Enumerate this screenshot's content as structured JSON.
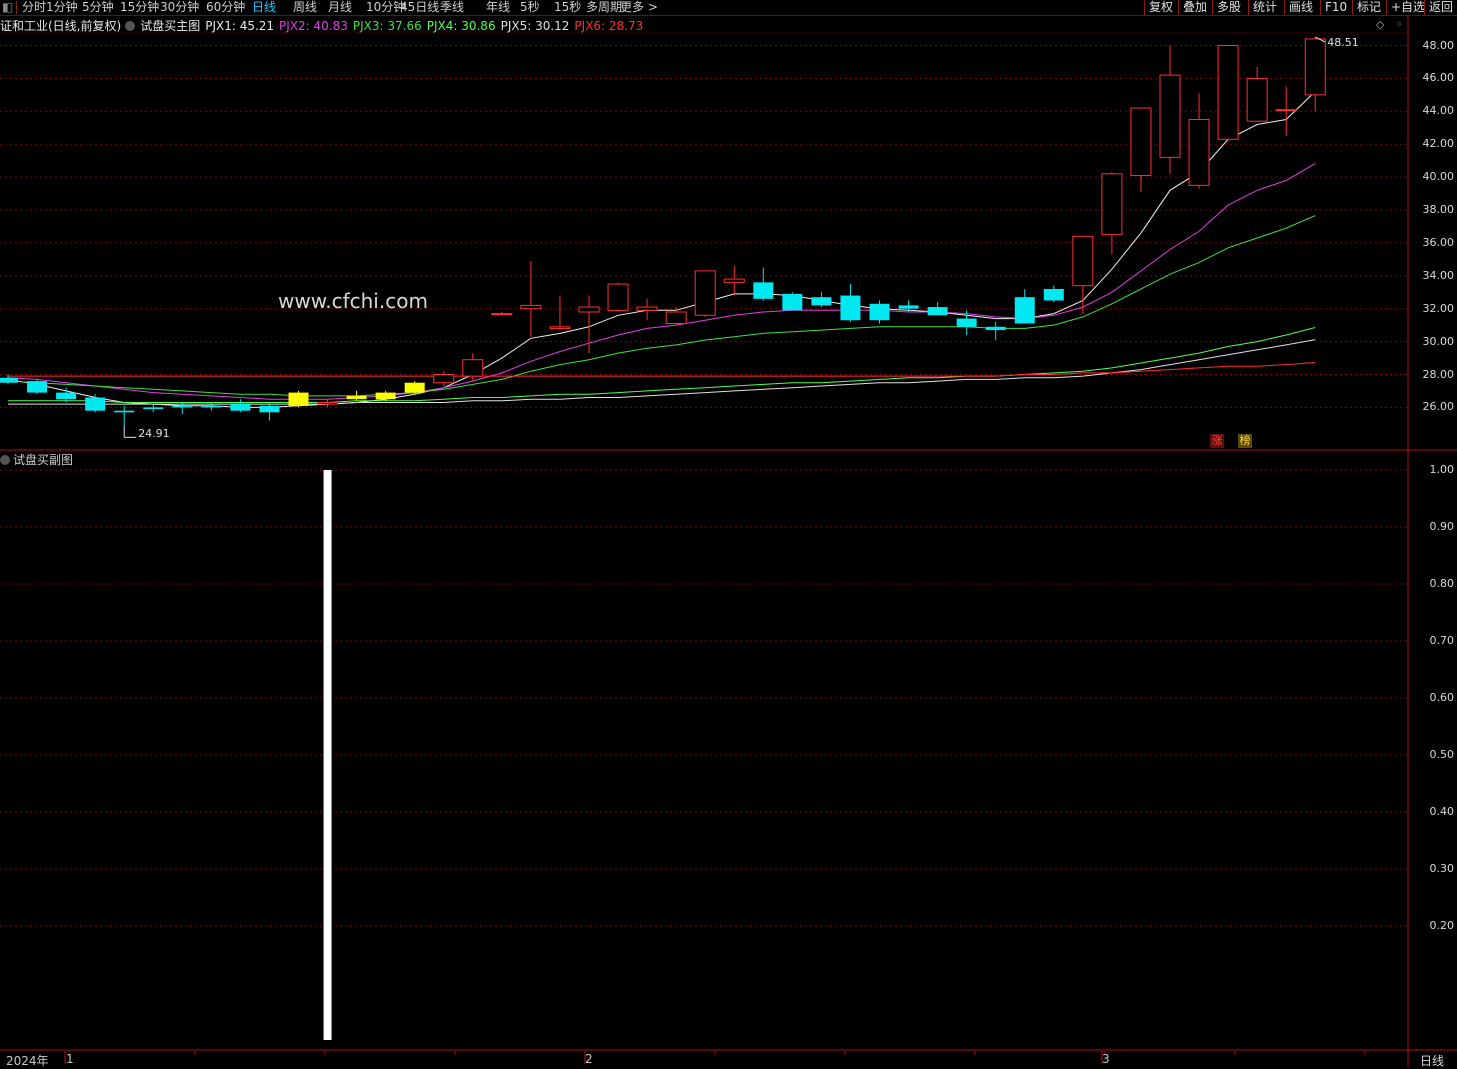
{
  "toolbar": {
    "left_items": [
      "分时",
      "1分钟",
      "5分钟",
      "15分钟",
      "30分钟",
      "60分钟",
      "日线",
      "周线",
      "月线",
      "10分钟",
      "45日线",
      "季线",
      "年线",
      "5秒",
      "15秒",
      "多周期",
      "更多 >"
    ],
    "active": "日线",
    "right_items": [
      "复权",
      "叠加",
      "多股",
      "统计",
      "画线",
      "F10",
      "标记",
      "+自选",
      "返回"
    ]
  },
  "legend": {
    "stock": "证和工业(日线,前复权)",
    "indicator": "试盘买主图",
    "items": [
      {
        "label": "PJX1: 45.21",
        "color": "#e8e8e8"
      },
      {
        "label": "PJX2: 40.83",
        "color": "#e040e0"
      },
      {
        "label": "PJX3: 37.66",
        "color": "#40e040"
      },
      {
        "label": "PJX4: 30.86",
        "color": "#50ff50"
      },
      {
        "label": "PJX5: 30.12",
        "color": "#e0e0e0"
      },
      {
        "label": "PJX6: 28.73",
        "color": "#ff3030"
      }
    ]
  },
  "watermark": "www.cfchi.com",
  "price_axis": [
    "48.00",
    "46.00",
    "44.00",
    "42.00",
    "40.00",
    "38.00",
    "36.00",
    "34.00",
    "32.00",
    "30.00",
    "28.00",
    "26.00"
  ],
  "high_label": "48.51",
  "low_label": "24.91",
  "tags": [
    "涨",
    "榜"
  ],
  "sub": {
    "title": "试盘买副图",
    "axis": [
      "1.00",
      "0.90",
      "0.80",
      "0.70",
      "0.60",
      "0.50",
      "0.40",
      "0.30",
      "0.20"
    ]
  },
  "timeline": {
    "year": "2024年",
    "months": [
      "1",
      "2",
      "3"
    ]
  },
  "period_label": "日线",
  "colors": {
    "up": "#ff3030",
    "down": "#00e8f0",
    "signal": "#ffff00",
    "grid": "#8a0000"
  },
  "chart_data": {
    "type": "candlestick",
    "ylim": [
      25.0,
      49.0
    ],
    "candles": [
      {
        "o": 27.8,
        "h": 28.0,
        "l": 27.4,
        "c": 27.5
      },
      {
        "o": 27.6,
        "h": 27.7,
        "l": 26.8,
        "c": 26.9
      },
      {
        "o": 26.9,
        "h": 27.2,
        "l": 26.3,
        "c": 26.5
      },
      {
        "o": 26.6,
        "h": 26.8,
        "l": 25.7,
        "c": 25.8
      },
      {
        "o": 25.8,
        "h": 26.1,
        "l": 24.91,
        "c": 25.7
      },
      {
        "o": 26.0,
        "h": 26.2,
        "l": 25.7,
        "c": 25.9
      },
      {
        "o": 26.1,
        "h": 26.3,
        "l": 25.6,
        "c": 26.0
      },
      {
        "o": 26.1,
        "h": 26.3,
        "l": 25.8,
        "c": 26.0
      },
      {
        "o": 26.2,
        "h": 26.5,
        "l": 25.7,
        "c": 25.8
      },
      {
        "o": 26.1,
        "h": 26.3,
        "l": 25.2,
        "c": 25.7
      },
      {
        "o": 26.1,
        "h": 27.0,
        "l": 26.0,
        "c": 26.9,
        "sig": true
      },
      {
        "o": 26.2,
        "h": 26.5,
        "l": 26.0,
        "c": 26.3
      },
      {
        "o": 26.5,
        "h": 27.0,
        "l": 26.4,
        "c": 26.7,
        "sig": true
      },
      {
        "o": 26.5,
        "h": 27.0,
        "l": 26.4,
        "c": 26.9,
        "sig": true
      },
      {
        "o": 26.9,
        "h": 27.6,
        "l": 26.8,
        "c": 27.5,
        "sig": true
      },
      {
        "o": 27.5,
        "h": 28.2,
        "l": 27.3,
        "c": 28.0
      },
      {
        "o": 27.9,
        "h": 29.3,
        "l": 27.6,
        "c": 28.9
      },
      {
        "o": 31.7,
        "h": 31.8,
        "l": 31.6,
        "c": 31.7
      },
      {
        "o": 32.0,
        "h": 34.9,
        "l": 30.3,
        "c": 32.2
      },
      {
        "o": 30.8,
        "h": 32.8,
        "l": 30.7,
        "c": 30.9
      },
      {
        "o": 31.8,
        "h": 32.8,
        "l": 29.3,
        "c": 32.1
      },
      {
        "o": 31.9,
        "h": 33.6,
        "l": 31.8,
        "c": 33.5
      },
      {
        "o": 31.9,
        "h": 32.6,
        "l": 31.3,
        "c": 32.1
      },
      {
        "o": 31.1,
        "h": 32.1,
        "l": 31.0,
        "c": 31.8
      },
      {
        "o": 31.6,
        "h": 34.3,
        "l": 31.5,
        "c": 34.3
      },
      {
        "o": 33.6,
        "h": 34.6,
        "l": 32.8,
        "c": 33.8
      },
      {
        "o": 33.6,
        "h": 34.5,
        "l": 32.5,
        "c": 32.6
      },
      {
        "o": 32.9,
        "h": 33.0,
        "l": 31.9,
        "c": 31.9
      },
      {
        "o": 32.7,
        "h": 33.0,
        "l": 32.1,
        "c": 32.2
      },
      {
        "o": 32.8,
        "h": 33.5,
        "l": 31.2,
        "c": 31.3
      },
      {
        "o": 32.3,
        "h": 32.5,
        "l": 31.1,
        "c": 31.3
      },
      {
        "o": 32.2,
        "h": 32.5,
        "l": 31.8,
        "c": 32.0
      },
      {
        "o": 32.1,
        "h": 32.4,
        "l": 31.6,
        "c": 31.6
      },
      {
        "o": 31.4,
        "h": 31.9,
        "l": 30.4,
        "c": 30.9
      },
      {
        "o": 30.9,
        "h": 31.2,
        "l": 30.1,
        "c": 30.7
      },
      {
        "o": 32.7,
        "h": 33.2,
        "l": 31.1,
        "c": 31.1
      },
      {
        "o": 33.2,
        "h": 33.4,
        "l": 32.4,
        "c": 32.5
      },
      {
        "o": 33.4,
        "h": 34.6,
        "l": 31.7,
        "c": 36.4
      },
      {
        "o": 36.5,
        "h": 40.3,
        "l": 35.3,
        "c": 40.2
      },
      {
        "o": 40.1,
        "h": 44.2,
        "l": 39.1,
        "c": 44.2
      },
      {
        "o": 41.2,
        "h": 48.0,
        "l": 40.2,
        "c": 46.2
      },
      {
        "o": 39.5,
        "h": 45.1,
        "l": 39.3,
        "c": 43.5
      },
      {
        "o": 42.3,
        "h": 48.0,
        "l": 42.2,
        "c": 48.0
      },
      {
        "o": 43.4,
        "h": 46.7,
        "l": 43.4,
        "c": 46.0
      },
      {
        "o": 44.1,
        "h": 45.5,
        "l": 42.5,
        "c": 44.1
      },
      {
        "o": 45.0,
        "h": 48.51,
        "l": 44.0,
        "c": 48.4
      }
    ],
    "series": [
      {
        "color": "#f0f0f0",
        "values": [
          27.7,
          27.4,
          27.0,
          26.6,
          26.3,
          26.2,
          26.1,
          26.1,
          26.0,
          26.0,
          26.1,
          26.2,
          26.3,
          26.5,
          26.8,
          27.2,
          28.0,
          29.0,
          30.2,
          30.5,
          30.9,
          31.6,
          31.9,
          31.9,
          32.4,
          32.9,
          32.9,
          32.8,
          32.5,
          32.2,
          32.0,
          31.9,
          31.8,
          31.6,
          31.4,
          31.4,
          31.7,
          32.5,
          34.4,
          36.6,
          39.2,
          40.3,
          42.3,
          43.2,
          43.5,
          45.21
        ]
      },
      {
        "color": "#e040e0",
        "values": [
          27.8,
          27.7,
          27.5,
          27.3,
          27.1,
          26.9,
          26.8,
          26.7,
          26.6,
          26.5,
          26.5,
          26.5,
          26.6,
          26.7,
          26.9,
          27.2,
          27.6,
          28.1,
          28.8,
          29.4,
          29.9,
          30.4,
          30.8,
          31.0,
          31.3,
          31.6,
          31.8,
          31.9,
          31.9,
          31.9,
          31.9,
          31.8,
          31.8,
          31.7,
          31.5,
          31.4,
          31.6,
          32.1,
          33.0,
          34.3,
          35.6,
          36.7,
          38.3,
          39.2,
          39.8,
          40.83
        ]
      },
      {
        "color": "#40e040",
        "values": [
          27.6,
          27.5,
          27.4,
          27.3,
          27.2,
          27.1,
          27.0,
          26.9,
          26.8,
          26.8,
          26.7,
          26.7,
          26.7,
          26.8,
          26.9,
          27.1,
          27.4,
          27.7,
          28.2,
          28.6,
          28.9,
          29.3,
          29.6,
          29.8,
          30.1,
          30.3,
          30.5,
          30.6,
          30.7,
          30.8,
          30.9,
          30.9,
          30.9,
          30.9,
          30.8,
          30.8,
          31.0,
          31.5,
          32.3,
          33.2,
          34.1,
          34.8,
          35.7,
          36.3,
          36.9,
          37.66
        ]
      },
      {
        "color": "#50ff50",
        "values": [
          26.4,
          26.4,
          26.4,
          26.4,
          26.3,
          26.3,
          26.3,
          26.3,
          26.3,
          26.3,
          26.3,
          26.3,
          26.4,
          26.4,
          26.4,
          26.5,
          26.6,
          26.6,
          26.7,
          26.8,
          26.8,
          26.9,
          27.0,
          27.1,
          27.2,
          27.3,
          27.4,
          27.5,
          27.5,
          27.6,
          27.7,
          27.8,
          27.8,
          27.9,
          27.9,
          28.0,
          28.1,
          28.2,
          28.4,
          28.7,
          29.0,
          29.3,
          29.7,
          30.0,
          30.4,
          30.86
        ]
      },
      {
        "color": "#e0e0e0",
        "values": [
          26.2,
          26.2,
          26.2,
          26.2,
          26.2,
          26.2,
          26.2,
          26.2,
          26.2,
          26.2,
          26.2,
          26.2,
          26.3,
          26.3,
          26.3,
          26.3,
          26.4,
          26.4,
          26.5,
          26.5,
          26.6,
          26.6,
          26.7,
          26.8,
          26.9,
          27.0,
          27.1,
          27.2,
          27.3,
          27.4,
          27.5,
          27.5,
          27.6,
          27.7,
          27.7,
          27.8,
          27.8,
          27.9,
          28.1,
          28.3,
          28.6,
          28.9,
          29.2,
          29.5,
          29.8,
          30.12
        ]
      },
      {
        "color": "#ff3030",
        "values": [
          27.9,
          27.9,
          27.9,
          27.9,
          27.9,
          27.9,
          27.9,
          27.9,
          27.9,
          27.9,
          27.9,
          27.9,
          27.9,
          27.9,
          27.9,
          27.9,
          27.9,
          27.9,
          27.9,
          27.9,
          27.9,
          27.9,
          27.9,
          27.9,
          27.9,
          27.9,
          27.9,
          27.9,
          27.9,
          27.9,
          27.9,
          27.9,
          27.9,
          27.9,
          27.9,
          28.0,
          28.0,
          28.1,
          28.1,
          28.2,
          28.3,
          28.4,
          28.5,
          28.5,
          28.6,
          28.73
        ]
      }
    ],
    "sub_bar": {
      "index": 11,
      "value": 1.0
    },
    "sub_ylim": [
      0.0,
      1.0
    ]
  }
}
